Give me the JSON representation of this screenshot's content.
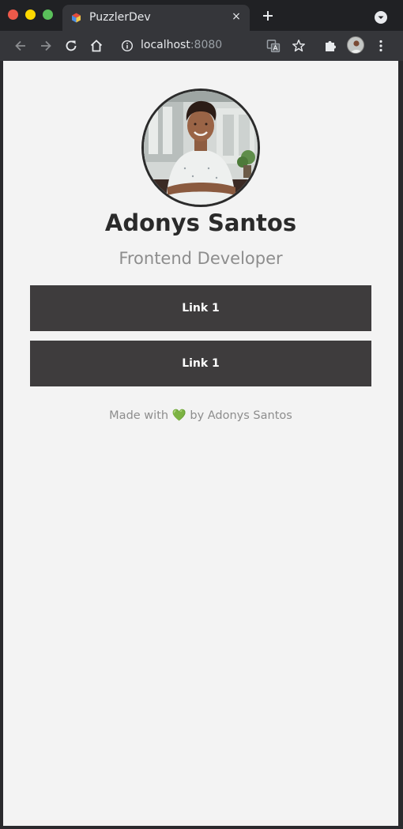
{
  "browser": {
    "tab_title": "PuzzlerDev",
    "tab_close": "×",
    "url_host": "localhost",
    "url_port": ":8080"
  },
  "profile": {
    "name": "Adonys Santos",
    "role": "Frontend Developer"
  },
  "links": [
    {
      "label": "Link 1"
    },
    {
      "label": "Link 1"
    }
  ],
  "footer": {
    "prefix": "Made with",
    "heart": "💚",
    "suffix": "by Adonys Santos"
  },
  "colors": {
    "page_bg": "#f3f3f3",
    "button_bg": "#3e3c3d",
    "name_text": "#2a2a2a",
    "muted_text": "#8d8d8d",
    "chrome_dark": "#202124",
    "chrome_toolbar": "#35363a"
  }
}
